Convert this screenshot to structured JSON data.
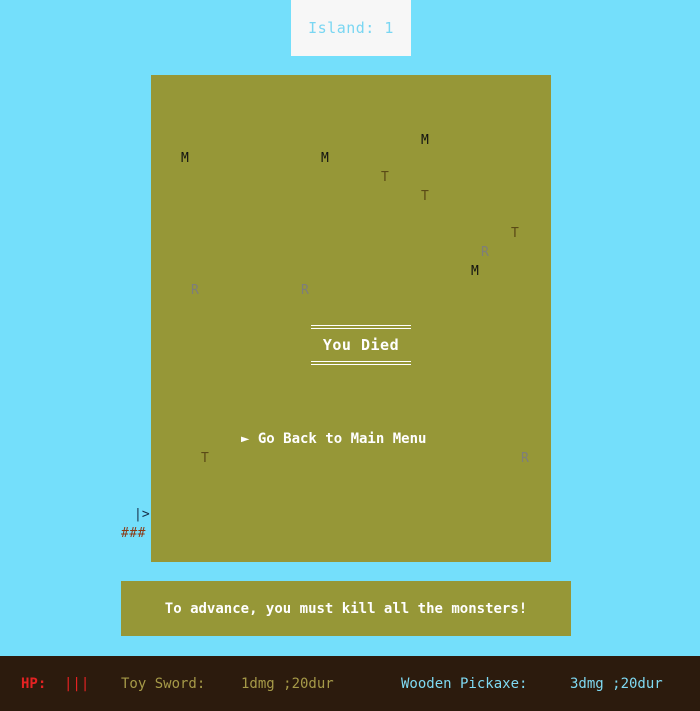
{
  "header": {
    "island_label": "Island: 1"
  },
  "map": {
    "monster_glyph": "M",
    "tree_glyph": "T",
    "rock_glyph": "R",
    "player_glyph": "|>",
    "bridge_glyph": "###"
  },
  "death_screen": {
    "title": "You Died",
    "option_label": "► Go Back to Main Menu"
  },
  "message": {
    "text": "To advance, you must kill all the monsters!"
  },
  "status": {
    "hp_label": "HP:",
    "hp_value": "|||",
    "weapon_label": "Toy Sword:",
    "weapon_value": "1dmg ;20dur",
    "tool_label": "Wooden Pickaxe:",
    "tool_value": "3dmg ;20dur"
  },
  "colors": {
    "sea": "#74dffb",
    "island": "#969737",
    "status_bar": "#2c1b0d",
    "hp": "#e42222",
    "weapon": "#a69a48",
    "tool": "#7fd9f2"
  }
}
